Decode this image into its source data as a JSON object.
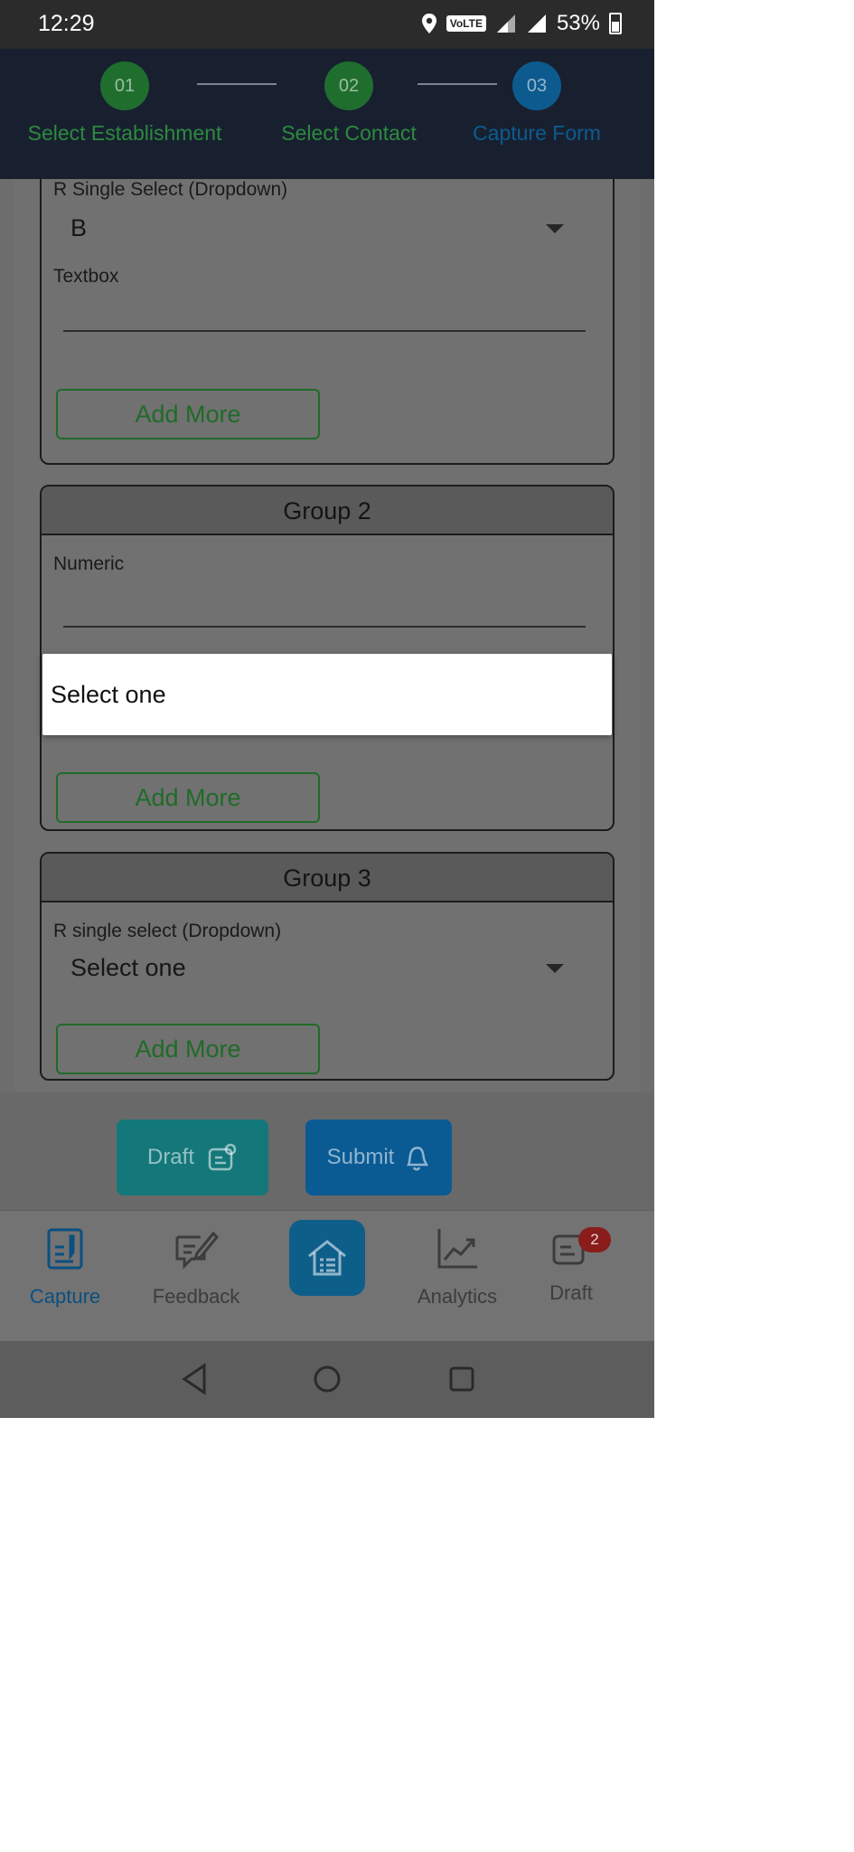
{
  "status_bar": {
    "time": "12:29",
    "network": "VoLTE",
    "battery": "53%"
  },
  "stepper": {
    "steps": [
      {
        "number": "01",
        "label": "Select Establishment",
        "state": "done"
      },
      {
        "number": "02",
        "label": "Select Contact",
        "state": "done"
      },
      {
        "number": "03",
        "label": "Capture Form",
        "state": "active"
      }
    ]
  },
  "form": {
    "group1": {
      "dropdown_label": "R Single Select (Dropdown)",
      "dropdown_value": "B",
      "textbox_label": "Textbox",
      "textbox_value": "",
      "add_more": "Add More"
    },
    "group2": {
      "title": "Group 2",
      "numeric_label": "Numeric",
      "numeric_value": "",
      "add_more": "Add More"
    },
    "group3": {
      "title": "Group 3",
      "dropdown_label": "R single select (Dropdown)",
      "dropdown_value": "Select one",
      "add_more": "Add More"
    }
  },
  "actions": {
    "draft": "Draft",
    "submit": "Submit"
  },
  "bottom_nav": {
    "capture": "Capture",
    "feedback": "Feedback",
    "analytics": "Analytics",
    "draft": "Draft",
    "draft_badge": "2"
  },
  "popup": {
    "options": [
      "Select one"
    ]
  },
  "colors": {
    "accent": "#0a78c8",
    "success": "#2e9e3e",
    "badge": "#e02424"
  }
}
